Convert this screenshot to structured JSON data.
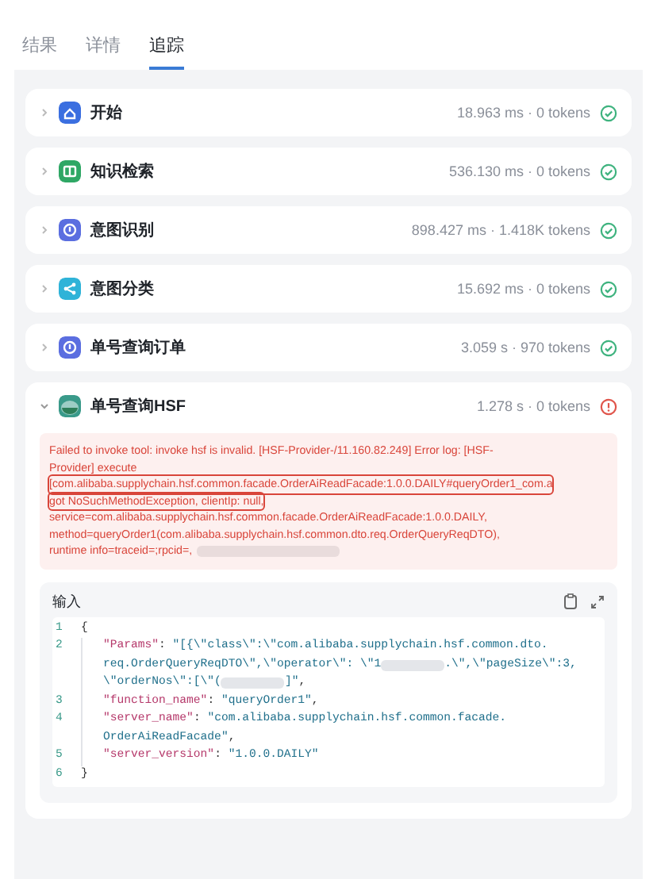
{
  "tabs": [
    {
      "label": "结果",
      "selected": false
    },
    {
      "label": "详情",
      "selected": false
    },
    {
      "label": "追踪",
      "selected": true
    }
  ],
  "steps": [
    {
      "name": "开始",
      "color": "#3b6fe0",
      "stats": "18.963 ms · 0 tokens",
      "failed": false,
      "expanded": false
    },
    {
      "name": "知识检索",
      "color": "#2fa765",
      "stats": "536.130 ms · 0 tokens",
      "failed": false,
      "expanded": false
    },
    {
      "name": "意图识别",
      "color": "#5b6ee0",
      "stats": "898.427 ms · 1.418K tokens",
      "failed": false,
      "expanded": false
    },
    {
      "name": "意图分类",
      "color": "#2fb3d8",
      "stats": "15.692 ms · 0 tokens",
      "failed": false,
      "expanded": false
    },
    {
      "name": "单号查询订单",
      "color": "#5b6ee0",
      "stats": "3.059 s · 970 tokens",
      "failed": false,
      "expanded": false
    },
    {
      "name": "单号查询HSF",
      "color": "#3a9a8a",
      "stats": "1.278 s · 0 tokens",
      "failed": true,
      "expanded": true
    }
  ],
  "error": {
    "lines": [
      {
        "text": "Failed to invoke tool: invoke hsf is invalid. [HSF-Provider-/11.160.82.249] Error log: [HSF-",
        "highlighted": false
      },
      {
        "text": "Provider] execute",
        "highlighted": false
      },
      {
        "text": "[com.alibaba.supplychain.hsf.common.facade.OrderAiReadFacade:1.0.0.DAILY#queryOrder1_com.a",
        "highlighted": true
      },
      {
        "text": "got NoSuchMethodException, clientIp: null,",
        "highlighted": true
      },
      {
        "text": "service=com.alibaba.supplychain.hsf.common.facade.OrderAiReadFacade:1.0.0.DAILY,",
        "highlighted": false
      },
      {
        "text": "method=queryOrder1(com.alibaba.supplychain.hsf.common.dto.req.OrderQueryReqDTO),",
        "highlighted": false
      },
      {
        "text": "runtime info=traceid=;rpcid=,",
        "highlighted": false,
        "redacted": true
      }
    ]
  },
  "input": {
    "title": "输入",
    "rows": [
      {
        "num": "1",
        "parts": [
          {
            "kind": "punct",
            "text": "{"
          }
        ]
      },
      {
        "num": "2",
        "parts": [
          {
            "kind": "key",
            "text": "\"Params\""
          },
          {
            "kind": "punct",
            "text": ": "
          },
          {
            "kind": "string",
            "text": "\"[{\\\"class\\\":\\\"com.alibaba.supplychain.hsf.common.dto."
          }
        ]
      },
      {
        "parts": [
          {
            "kind": "string",
            "text": "req.OrderQueryReqDTO\\\",\\\"operator\\\": \\\"1"
          },
          {
            "kind": "redacted"
          },
          {
            "kind": "string",
            "text": ".\\\",\\\"pageSize\\\":3,"
          }
        ]
      },
      {
        "parts": [
          {
            "kind": "string",
            "text": "\\\"orderNos\\\":[\\\"("
          },
          {
            "kind": "redacted"
          },
          {
            "kind": "string",
            "text": "]\""
          },
          {
            "kind": "punct",
            "text": ","
          }
        ]
      },
      {
        "num": "3",
        "parts": [
          {
            "kind": "key",
            "text": "\"function_name\""
          },
          {
            "kind": "punct",
            "text": ": "
          },
          {
            "kind": "string",
            "text": "\"queryOrder1\""
          },
          {
            "kind": "punct",
            "text": ","
          }
        ]
      },
      {
        "num": "4",
        "parts": [
          {
            "kind": "key",
            "text": "\"server_name\""
          },
          {
            "kind": "punct",
            "text": ": "
          },
          {
            "kind": "string",
            "text": "\"com.alibaba.supplychain.hsf.common.facade."
          }
        ]
      },
      {
        "parts": [
          {
            "kind": "string",
            "text": "OrderAiReadFacade\""
          },
          {
            "kind": "punct",
            "text": ","
          }
        ]
      },
      {
        "num": "5",
        "parts": [
          {
            "kind": "key",
            "text": "\"server_version\""
          },
          {
            "kind": "punct",
            "text": ": "
          },
          {
            "kind": "string",
            "text": "\"1.0.0.DAILY\""
          }
        ]
      },
      {
        "num": "6",
        "parts": [
          {
            "kind": "punct",
            "text": "}"
          }
        ]
      }
    ]
  }
}
